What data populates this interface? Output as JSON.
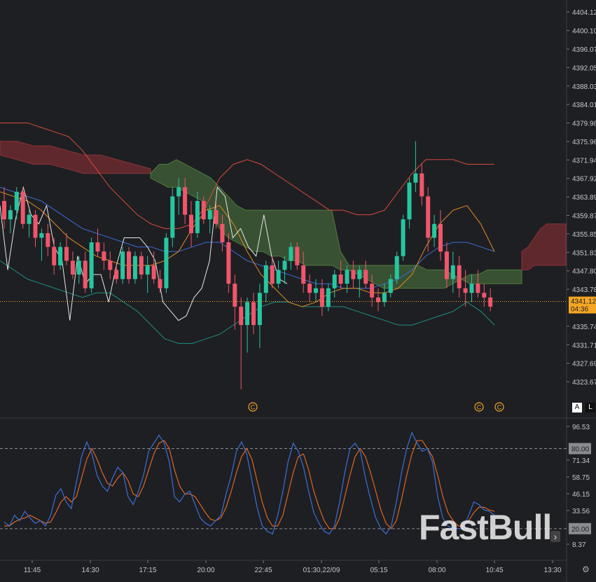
{
  "colors": {
    "background": "#1e1f23",
    "grid": "#2a2b30",
    "bull": "#26c6a0",
    "bear": "#f0566a",
    "cloud_bull": "#3d5a35",
    "cloud_bear": "#6b2a2e",
    "bb_outer_top": "#d94a3a",
    "bb_outer_bottom": "#1f8f80",
    "ma_blue": "#3b6ed6",
    "ma_orange": "#e08a1e",
    "white_line": "#e6e6e6",
    "stoch_k": "#3b6ed6",
    "stoch_d": "#e0651e",
    "price_tag": "#f5a623"
  },
  "brand": {
    "watermark": "FastBull"
  },
  "controls": {
    "auto_label": "A",
    "log_label": "L",
    "scroll_icon": "chevron-right-icon",
    "settings_icon": "gear-icon"
  },
  "chart_data": [
    {
      "type": "candlestick",
      "y_axis_ticks": [
        "4404.12",
        "4400.10",
        "4396.07",
        "4392.05",
        "4388.03",
        "4384.01",
        "4379.98",
        "4375.96",
        "4371.94",
        "4367.92",
        "4363.89",
        "4359.87",
        "4355.85",
        "4351.83",
        "4347.80",
        "4343.78",
        "4335.74",
        "4331.71",
        "4327.69",
        "4323.67"
      ],
      "ylim": [
        4321.0,
        4406.0
      ],
      "x_axis_ticks": [
        "11:45",
        "14:30",
        "17:15",
        "20:00",
        "22:45",
        "01:30,22/09",
        "05:15",
        "08:00",
        "10:45",
        "13:30"
      ],
      "last_price": "4341.12",
      "countdown": "04:36",
      "event_markers": [
        "C",
        "C",
        "C"
      ],
      "candles": [
        [
          4363,
          4366,
          4357,
          4359
        ],
        [
          4359,
          4362,
          4356,
          4361
        ],
        [
          4361,
          4366,
          4359,
          4365
        ],
        [
          4365,
          4366,
          4357,
          4358
        ],
        [
          4358,
          4361,
          4355,
          4360
        ],
        [
          4360,
          4361,
          4353,
          4355
        ],
        [
          4355,
          4357,
          4350,
          4356
        ],
        [
          4356,
          4358,
          4351,
          4353
        ],
        [
          4353,
          4355,
          4347,
          4349
        ],
        [
          4349,
          4354,
          4348,
          4353
        ],
        [
          4353,
          4356,
          4349,
          4350
        ],
        [
          4350,
          4352,
          4346,
          4347
        ],
        [
          4347,
          4351,
          4345,
          4350
        ],
        [
          4350,
          4352,
          4343,
          4344
        ],
        [
          4344,
          4355,
          4343,
          4354
        ],
        [
          4354,
          4357,
          4351,
          4352
        ],
        [
          4352,
          4354,
          4348,
          4350
        ],
        [
          4350,
          4352,
          4346,
          4348
        ],
        [
          4348,
          4349,
          4345,
          4346
        ],
        [
          4346,
          4353,
          4345,
          4352
        ],
        [
          4352,
          4353,
          4345,
          4346
        ],
        [
          4346,
          4352,
          4345,
          4351
        ],
        [
          4351,
          4352,
          4346,
          4347
        ],
        [
          4347,
          4351,
          4343,
          4349
        ],
        [
          4349,
          4352,
          4345,
          4346
        ],
        [
          4346,
          4348,
          4343,
          4344
        ],
        [
          4344,
          4356,
          4343,
          4355
        ],
        [
          4355,
          4366,
          4353,
          4364
        ],
        [
          4364,
          4368,
          4360,
          4366
        ],
        [
          4366,
          4368,
          4358,
          4360
        ],
        [
          4360,
          4363,
          4353,
          4356
        ],
        [
          4356,
          4365,
          4355,
          4363
        ],
        [
          4363,
          4364,
          4358,
          4359
        ],
        [
          4359,
          4362,
          4356,
          4361
        ],
        [
          4361,
          4363,
          4357,
          4358
        ],
        [
          4358,
          4360,
          4352,
          4354
        ],
        [
          4354,
          4356,
          4343,
          4345
        ],
        [
          4345,
          4347,
          4335,
          4340
        ],
        [
          4340,
          4342,
          4322,
          4336
        ],
        [
          4336,
          4342,
          4330,
          4341
        ],
        [
          4341,
          4343,
          4334,
          4336
        ],
        [
          4336,
          4345,
          4331,
          4343
        ],
        [
          4343,
          4350,
          4341,
          4349
        ],
        [
          4349,
          4351,
          4344,
          4345
        ],
        [
          4345,
          4350,
          4344,
          4348
        ],
        [
          4348,
          4351,
          4345,
          4350
        ],
        [
          4350,
          4354,
          4348,
          4353
        ],
        [
          4353,
          4354,
          4348,
          4349
        ],
        [
          4349,
          4352,
          4343,
          4345
        ],
        [
          4345,
          4347,
          4341,
          4343
        ],
        [
          4343,
          4346,
          4341,
          4344
        ],
        [
          4344,
          4346,
          4338,
          4340
        ],
        [
          4340,
          4345,
          4339,
          4344
        ],
        [
          4344,
          4348,
          4342,
          4347
        ],
        [
          4347,
          4350,
          4344,
          4345
        ],
        [
          4345,
          4349,
          4343,
          4348
        ],
        [
          4348,
          4350,
          4344,
          4346
        ],
        [
          4346,
          4349,
          4342,
          4348
        ],
        [
          4348,
          4350,
          4344,
          4345
        ],
        [
          4345,
          4347,
          4340,
          4342
        ],
        [
          4342,
          4344,
          4339,
          4341
        ],
        [
          4341,
          4345,
          4340,
          4343
        ],
        [
          4343,
          4347,
          4342,
          4346
        ],
        [
          4346,
          4352,
          4345,
          4351
        ],
        [
          4351,
          4360,
          4350,
          4359
        ],
        [
          4359,
          4368,
          4357,
          4367
        ],
        [
          4367,
          4376,
          4365,
          4369
        ],
        [
          4369,
          4371,
          4362,
          4364
        ],
        [
          4364,
          4366,
          4352,
          4355
        ],
        [
          4355,
          4360,
          4353,
          4358
        ],
        [
          4358,
          4361,
          4350,
          4352
        ],
        [
          4352,
          4354,
          4344,
          4346
        ],
        [
          4346,
          4352,
          4343,
          4349
        ],
        [
          4349,
          4351,
          4342,
          4344
        ],
        [
          4344,
          4348,
          4340,
          4343
        ],
        [
          4343,
          4347,
          4341,
          4345
        ],
        [
          4345,
          4348,
          4342,
          4343
        ],
        [
          4343,
          4345,
          4340,
          4342
        ],
        [
          4342,
          4344,
          4339,
          4340
        ]
      ],
      "cloud_segments": [
        {
          "color": "bear",
          "upper": [
            4376,
            4376,
            4375,
            4375,
            4374,
            4373,
            4373,
            4372,
            4371,
            4370
          ],
          "lower": [
            4373,
            4372,
            4371,
            4371,
            4370,
            4369,
            4369,
            4369,
            4369,
            4369
          ]
        },
        {
          "color": "bull",
          "upper": [
            4369,
            4371,
            4371,
            4372,
            4371,
            4370,
            4369,
            4368,
            4366,
            4364,
            4362,
            4361,
            4361,
            4361,
            4361,
            4361,
            4361,
            4361,
            4361,
            4361,
            4361,
            4361,
            4352,
            4349,
            4349,
            4349,
            4349,
            4349,
            4349,
            4349,
            4349,
            4349,
            4348,
            4348,
            4348,
            4347,
            4346,
            4345,
            4345,
            4345,
            4345,
            4345,
            4345,
            4345
          ],
          "lower": [
            4368,
            4367,
            4366,
            4366,
            4365,
            4364,
            4363,
            4360,
            4357,
            4355,
            4354,
            4353,
            4352,
            4352,
            4351,
            4351,
            4350,
            4350,
            4349,
            4349,
            4349,
            4349,
            4348,
            4348,
            4347,
            4346,
            4345,
            4344,
            4344,
            4344,
            4344,
            4344,
            4344,
            4344,
            4344,
            4345,
            4346,
            4347,
            4347,
            4348,
            4348,
            4348,
            4348,
            4348
          ]
        },
        {
          "color": "bear",
          "upper": [
            4352,
            4353,
            4355,
            4357,
            4358,
            4358,
            4358,
            4358
          ],
          "lower": [
            4348,
            4348,
            4349,
            4349,
            4349,
            4349,
            4349,
            4349
          ]
        }
      ],
      "bb_upper": [
        4380,
        4380,
        4380,
        4379,
        4378,
        4377,
        4374,
        4370,
        4366,
        4363,
        4360,
        4358,
        4357,
        4357,
        4358,
        4362,
        4368,
        4371,
        4372,
        4371,
        4369,
        4367,
        4365,
        4363,
        4361,
        4361,
        4360,
        4360,
        4361,
        4365,
        4369,
        4372,
        4372,
        4372,
        4371,
        4371,
        4371
      ],
      "bb_lower": [
        4350,
        4348,
        4346,
        4345,
        4344,
        4343,
        4342,
        4343,
        4343,
        4341,
        4339,
        4336,
        4333,
        4332,
        4332,
        4333,
        4334,
        4336,
        4338,
        4340,
        4341,
        4341,
        4340,
        4340,
        4340,
        4340,
        4339,
        4338,
        4337,
        4336,
        4336,
        4337,
        4338,
        4339,
        4341,
        4339,
        4336
      ],
      "ma_blue": [
        4366,
        4365,
        4364,
        4363,
        4361,
        4359,
        4357,
        4356,
        4355,
        4354,
        4353,
        4353,
        4352,
        4352,
        4353,
        4354,
        4354,
        4352,
        4350,
        4349,
        4348,
        4347,
        4346,
        4345,
        4345,
        4344,
        4344,
        4344,
        4345,
        4346,
        4348,
        4351,
        4353,
        4354,
        4354,
        4353,
        4352
      ],
      "ma_orange": [
        4365,
        4364,
        4363,
        4361,
        4358,
        4355,
        4353,
        4351,
        4350,
        4349,
        4349,
        4349,
        4350,
        4352,
        4357,
        4361,
        4362,
        4358,
        4352,
        4347,
        4344,
        4341,
        4340,
        4341,
        4343,
        4344,
        4344,
        4343,
        4343,
        4344,
        4347,
        4353,
        4358,
        4361,
        4362,
        4358,
        4352
      ],
      "white_line": [
        4362,
        4348,
        4359,
        4366,
        4360,
        4358,
        4362,
        4353,
        4350,
        4337,
        4351,
        4345,
        4347,
        4347,
        4341,
        4349,
        4355,
        4355,
        4355,
        4353,
        4350,
        4341,
        4339,
        4337,
        4338,
        4342,
        4344,
        4350,
        4366,
        4364,
        4355,
        4357,
        4353,
        4351,
        4360,
        4351,
        4346,
        4345
      ]
    },
    {
      "type": "line",
      "title": "",
      "y_axis_ticks": [
        "96.53",
        "71.34",
        "58.75",
        "46.15",
        "33.56",
        "8.37"
      ],
      "reference_lines": [
        "80.00",
        "20.00"
      ],
      "ylim": [
        2,
        100
      ],
      "series": [
        {
          "values": [
            25,
            22,
            30,
            26,
            33,
            28,
            24,
            26,
            22,
            30,
            45,
            50,
            40,
            35,
            55,
            74,
            85,
            76,
            60,
            52,
            48,
            58,
            66,
            62,
            44,
            38,
            48,
            60,
            78,
            84,
            90,
            84,
            70,
            44,
            40,
            46,
            48,
            38,
            28,
            24,
            22,
            26,
            30,
            46,
            60,
            78,
            85,
            76,
            56,
            36,
            22,
            18,
            16,
            30,
            48,
            70,
            84,
            78,
            66,
            48,
            32,
            24,
            18,
            16,
            22,
            40,
            62,
            80,
            84,
            78,
            58,
            42,
            28,
            20,
            16,
            22,
            40,
            62,
            80,
            92,
            84,
            78,
            80,
            70,
            44,
            28,
            22,
            20,
            20,
            20,
            30,
            40,
            38,
            34,
            33,
            30
          ]
        },
        {
          "values": [
            22,
            22,
            25,
            27,
            28,
            30,
            28,
            26,
            24,
            25,
            32,
            40,
            44,
            40,
            44,
            58,
            72,
            80,
            72,
            62,
            54,
            52,
            58,
            62,
            56,
            46,
            44,
            52,
            64,
            76,
            84,
            86,
            80,
            64,
            52,
            46,
            46,
            44,
            38,
            32,
            27,
            26,
            28,
            36,
            48,
            62,
            74,
            80,
            72,
            56,
            40,
            28,
            22,
            22,
            30,
            46,
            62,
            74,
            76,
            64,
            48,
            36,
            26,
            20,
            20,
            28,
            44,
            60,
            74,
            80,
            74,
            62,
            48,
            34,
            24,
            20,
            26,
            42,
            60,
            76,
            86,
            86,
            80,
            74,
            60,
            44,
            32,
            26,
            22,
            22,
            26,
            32,
            36,
            36,
            34,
            33
          ]
        }
      ]
    }
  ]
}
